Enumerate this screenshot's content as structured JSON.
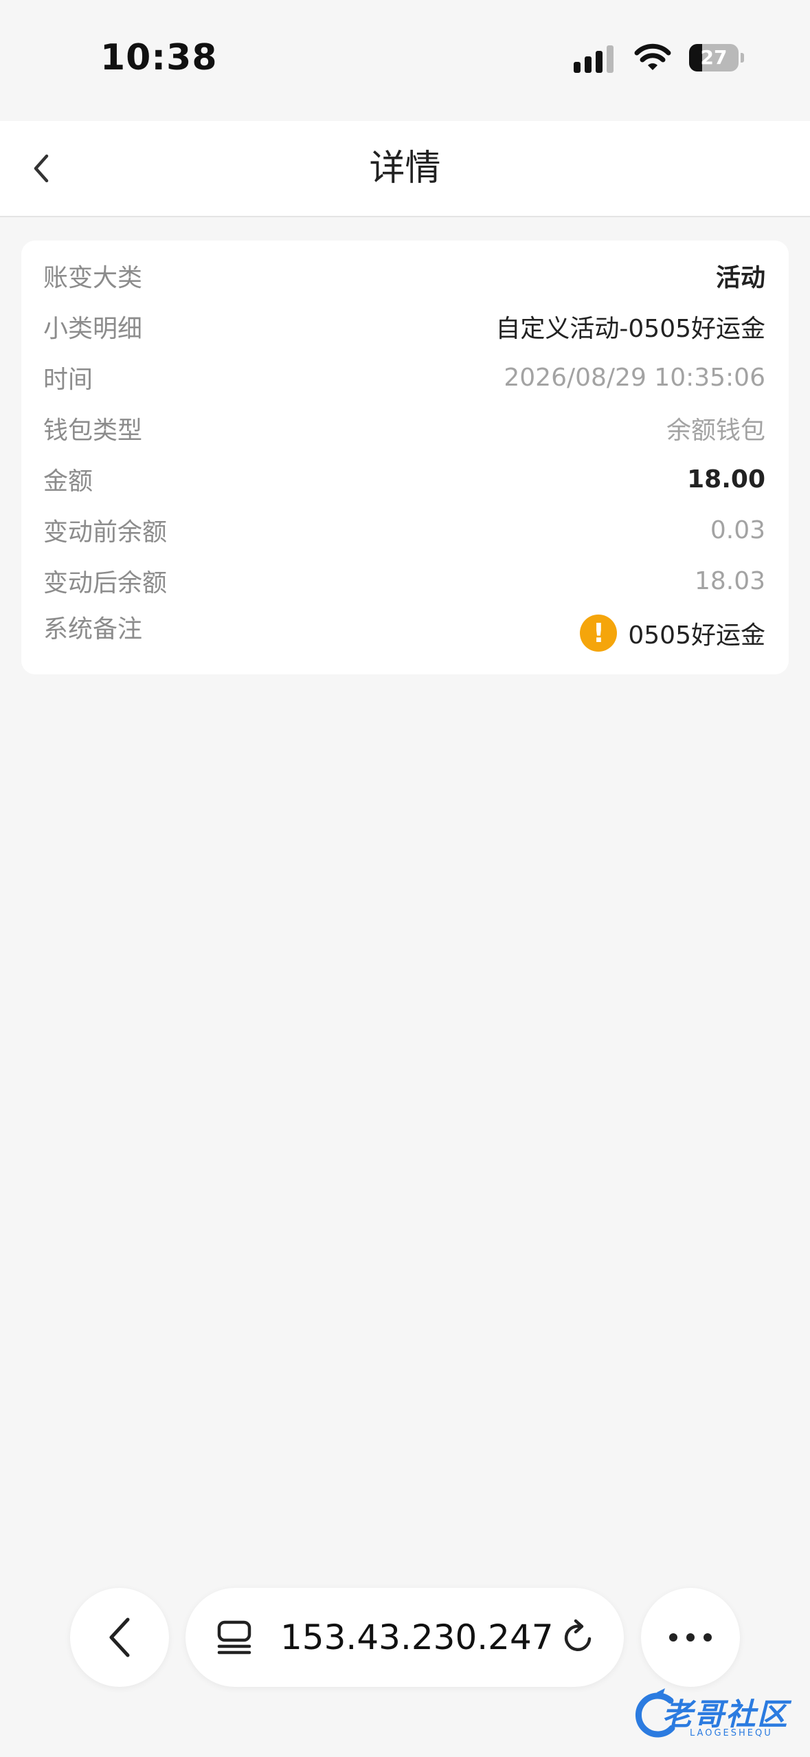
{
  "status_bar": {
    "time": "10:38",
    "battery": "27",
    "icons": [
      "signal-icon",
      "wifi-icon",
      "battery-icon"
    ]
  },
  "nav": {
    "title": "详情",
    "back_icon": "chevron-left-icon"
  },
  "details": {
    "category": {
      "label": "账变大类",
      "value": "活动"
    },
    "subcategory": {
      "label": "小类明细",
      "value": "自定义活动-0505好运金"
    },
    "time": {
      "label": "时间",
      "value": "2026/08/29 10:35:06"
    },
    "wallet": {
      "label": "钱包类型",
      "value": "余额钱包"
    },
    "amount": {
      "label": "金额",
      "value": "18.00"
    },
    "before": {
      "label": "变动前余额",
      "value": "0.03"
    },
    "after": {
      "label": "变动后余额",
      "value": "18.03"
    },
    "remark": {
      "label": "系统备注",
      "value": "0505好运金",
      "icon": "warning-icon"
    }
  },
  "browser": {
    "address": "153.43.230.247",
    "icons": [
      "back-arrow-icon",
      "tabs-icon",
      "reload-icon",
      "more-icon"
    ]
  },
  "watermark": {
    "text": "老哥社区",
    "sub": "LAOGESHEQU"
  },
  "colors": {
    "background": "#f6f6f6",
    "card": "#ffffff",
    "label": "#8c8c8c",
    "muted_value": "#a3a3a3",
    "warning": "#f5a50b",
    "watermark": "#2b7be0"
  }
}
